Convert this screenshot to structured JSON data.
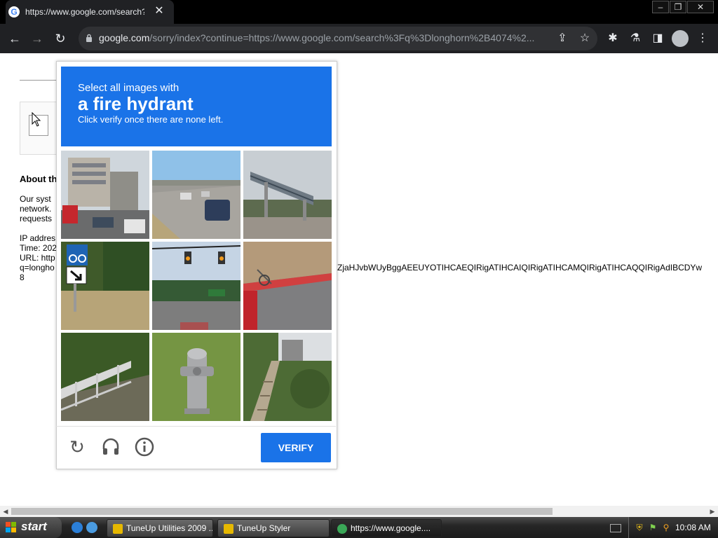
{
  "browser": {
    "tab": {
      "title": "https://www.google.com/search?q=",
      "favicon": "G"
    },
    "omnibox": {
      "host": "google.com",
      "path": "/sorry/index?continue=https://www.google.com/search%3Fq%3Dlonghorn%2B4074%2..."
    },
    "window_controls": {
      "minimize": "–",
      "restore": "❐",
      "close": "✕"
    }
  },
  "page": {
    "about_heading": "About th",
    "lines": [
      "Our syst",
      "network.",
      "requests",
      "IP addres",
      "Time: 202",
      "URL: http",
      "q=longho",
      "8"
    ],
    "url_tail": "ZjaHJvbWUyBggAEEUYOTIHCAEQIRigATIHCAIQIRigATIHCAMQIRigATIHCAQQIRigAdIBCDYw"
  },
  "captcha": {
    "instruction": "Select all images with",
    "target": "a fire hydrant",
    "subtext": "Click verify once there are none left.",
    "verify_label": "VERIFY",
    "tiles": [
      "street-buildings",
      "highway-traffic",
      "pedestrian-bridge",
      "bike-sign",
      "traffic-lights",
      "red-curb-road",
      "railing-grass",
      "fire-hydrant",
      "garden-stairs"
    ]
  },
  "taskbar": {
    "start_label": "start",
    "buttons": [
      {
        "label": "TuneUp Utilities 2009 ..."
      },
      {
        "label": "TuneUp Styler"
      },
      {
        "label": "https://www.google...."
      }
    ],
    "clock": "10:08 AM"
  }
}
